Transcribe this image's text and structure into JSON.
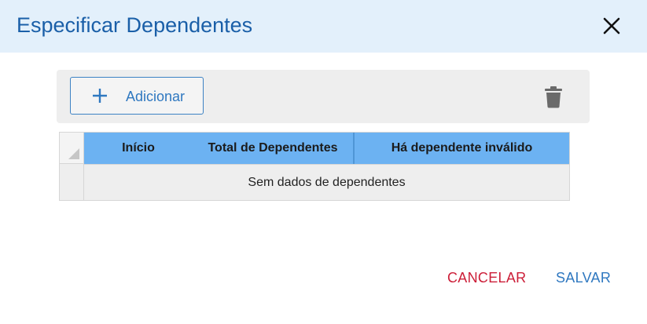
{
  "dialog": {
    "title": "Especificar Dependentes",
    "close_icon": "close-icon"
  },
  "toolbar": {
    "add_label": "Adicionar",
    "add_icon": "plus-icon",
    "delete_icon": "trash-icon"
  },
  "grid": {
    "columns": [
      "Início",
      "Total de Dependentes",
      "Há dependente inválido"
    ],
    "empty_message": "Sem dados de dependentes"
  },
  "footer": {
    "cancel_label": "CANCELAR",
    "save_label": "SALVAR"
  },
  "colors": {
    "header_bg": "#e3f0fb",
    "title": "#1a5fa8",
    "accent": "#2f78c0",
    "column_header_bg": "#6cb2f2",
    "cancel": "#cc1e38"
  }
}
